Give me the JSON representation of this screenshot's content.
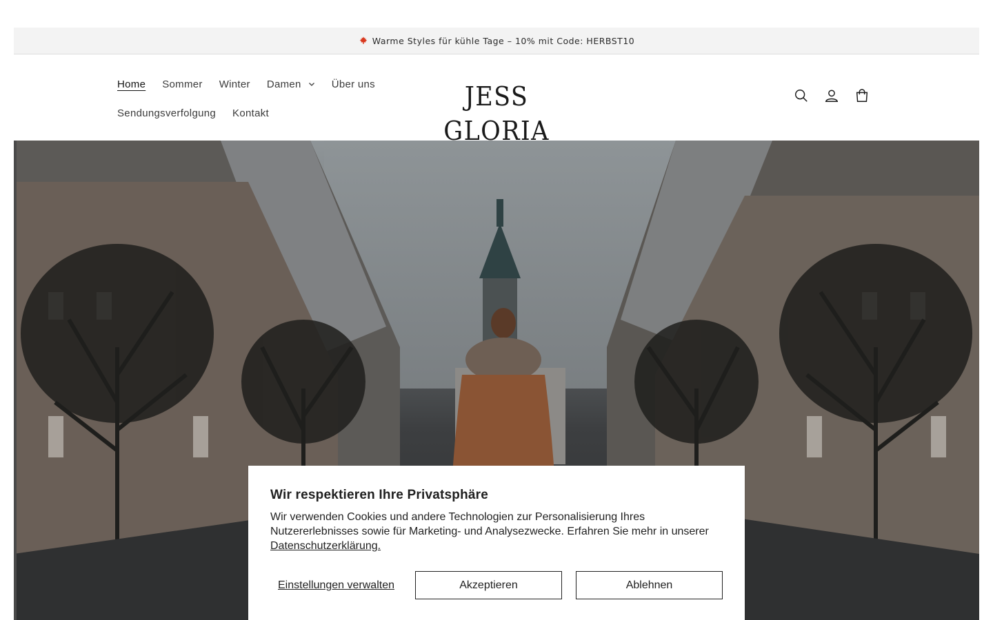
{
  "announcement": {
    "text": "Warme Styles für kühle Tage – 10% mit Code: HERBST10",
    "icon": "maple-leaf-icon"
  },
  "nav": {
    "row1": [
      {
        "label": "Home",
        "active": true
      },
      {
        "label": "Sommer"
      },
      {
        "label": "Winter"
      },
      {
        "label": "Damen",
        "dropdown": true
      },
      {
        "label": "Über uns"
      }
    ],
    "row2": [
      {
        "label": "Sendungsverfolgung"
      },
      {
        "label": "Kontakt"
      }
    ]
  },
  "logo": {
    "text": "JESS GLORIA"
  },
  "header_icons": [
    "search-icon",
    "account-icon",
    "cart-icon"
  ],
  "cookie": {
    "title": "Wir respektieren Ihre Privatsphäre",
    "body": "Wir verwenden Cookies und andere Technologien zur Personalisierung Ihres Nutzererlebnisses sowie für Marketing- und Analysezwecke. Erfahren Sie mehr in unserer ",
    "link": "Datenschutzerklärung.",
    "manage_label": "Einstellungen verwalten",
    "accept_label": "Akzeptieren",
    "decline_label": "Ablehnen"
  },
  "colors": {
    "announcement_bg": "#f3f3f3",
    "text": "#121212",
    "leaf": "#d9381e"
  }
}
